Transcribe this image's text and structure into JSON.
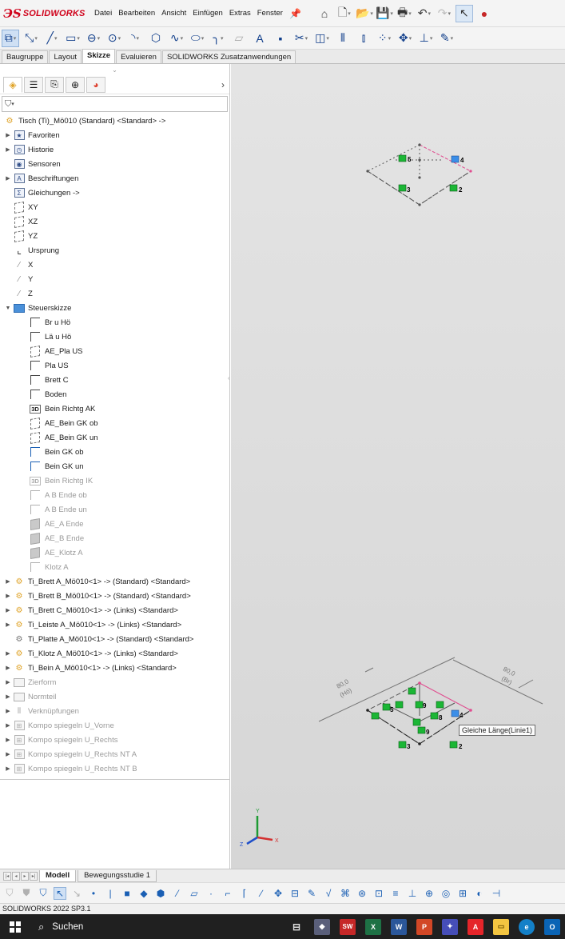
{
  "app": {
    "logo_ds": "ЭS",
    "logo_brand": "SOLIDWORKS"
  },
  "menu": [
    "Datei",
    "Bearbeiten",
    "Ansicht",
    "Einfügen",
    "Extras",
    "Fenster"
  ],
  "command_tabs": [
    "Baugruppe",
    "Layout",
    "Skizze",
    "Evaluieren",
    "SOLIDWORKS Zusatzanwendungen"
  ],
  "tree": {
    "root": "Tisch (Ti)_Mö010 (Standard) <Standard> ->",
    "items": [
      {
        "label": "Favoriten"
      },
      {
        "label": "Historie"
      },
      {
        "label": "Sensoren"
      },
      {
        "label": "Beschriftungen"
      },
      {
        "label": "Gleichungen ->"
      },
      {
        "label": "XY"
      },
      {
        "label": "XZ"
      },
      {
        "label": "YZ"
      },
      {
        "label": "Ursprung"
      },
      {
        "label": "X"
      },
      {
        "label": "Y"
      },
      {
        "label": "Z"
      },
      {
        "label": "Steuerskizze"
      }
    ],
    "steuerskizze_children": [
      "Br u Hö",
      "Lä u Hö",
      "AE_Pla US",
      "Pla US",
      "Brett C",
      "Boden",
      "Bein Richtg AK",
      "AE_Bein GK ob",
      "AE_Bein GK un",
      "Bein GK ob",
      "Bein GK un",
      "Bein Richtg IK",
      "A B Ende ob",
      "A B Ende un",
      "AE_A Ende",
      "AE_B Ende",
      "AE_Klotz A",
      "Klotz A"
    ],
    "components": [
      "Ti_Brett A_Mö010<1> -> (Standard) <Standard>",
      "Ti_Brett B_Mö010<1> -> (Standard) <Standard>",
      "Ti_Brett C_Mö010<1> -> (Links) <Standard>",
      "Ti_Leiste A_Mö010<1> -> (Links) <Standard>",
      "Ti_Platte A_Mö010<1> -> (Standard) <Standard>",
      "Ti_Klotz A_Mö010<1> -> (Links) <Standard>",
      "Ti_Bein A_Mö010<1> -> (Links) <Standard>"
    ],
    "greyed": [
      "Zierform",
      "Normteil",
      "Verknüpfungen",
      "Kompo spiegeln U_Vorne",
      "Kompo spiegeln U_Rechts",
      "Kompo spiegeln U_Rechts NT A",
      "Kompo spiegeln U_Rechts NT B"
    ]
  },
  "viewport": {
    "tooltip": "Gleiche Länge(Linie1)",
    "top_labels": [
      "5",
      "4",
      "3",
      "2"
    ],
    "bottom_labels": [
      "5",
      "9",
      "4",
      "8",
      "9",
      "3",
      "2"
    ],
    "dim_left": "80,0",
    "dim_left_sub": "(Hö)",
    "dim_right": "80,0",
    "dim_right_sub": "(Br)"
  },
  "bottom_tabs": [
    "Modell",
    "Bewegungsstudie 1"
  ],
  "status": "SOLIDWORKS 2022 SP3.1",
  "taskbar": {
    "search": "Suchen"
  }
}
